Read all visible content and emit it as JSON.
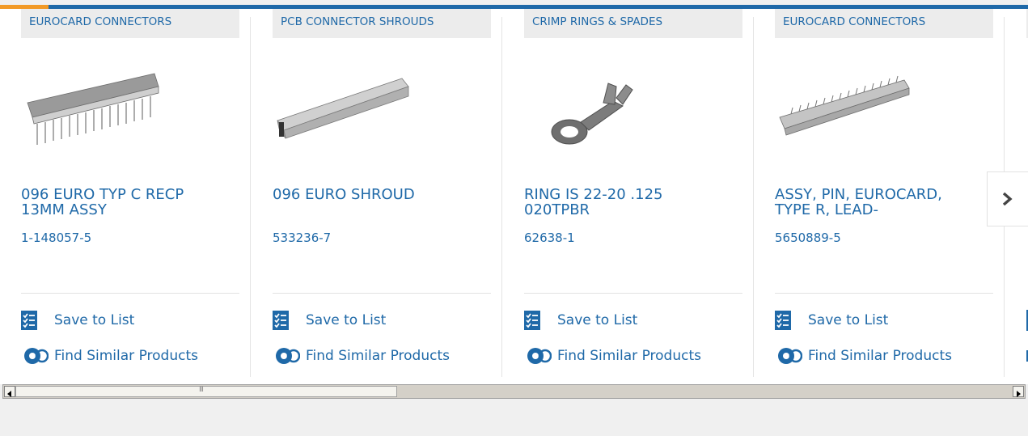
{
  "colors": {
    "link": "#1f69a8",
    "accent": "#f29a27",
    "category_bg": "#ececec"
  },
  "save_label": "Save to List",
  "find_label": "Find Similar Products",
  "cards": [
    {
      "category": "EUROCARD CONNECTORS",
      "title": "096 EURO TYP C RECP 13MM ASSY",
      "part_number": "1-148057-5",
      "image_icon": "eurocard-receptacle-image"
    },
    {
      "category": "PCB CONNECTOR SHROUDS",
      "title": "096 EURO SHROUD",
      "part_number": "533236-7",
      "image_icon": "connector-shroud-image"
    },
    {
      "category": "CRIMP RINGS & SPADES",
      "title": "RING IS 22-20 .125 020TPBR",
      "part_number": "62638-1",
      "image_icon": "ring-terminal-image"
    },
    {
      "category": "EUROCARD CONNECTORS",
      "title": "ASSY, PIN, EUROCARD, TYPE R, LEAD-",
      "part_number": "5650889-5",
      "image_icon": "eurocard-pin-assembly-image"
    }
  ],
  "next_icon": "chevron-right-icon",
  "scrollbar": {
    "left_arrow_icon": "scroll-left-arrow-icon",
    "right_arrow_icon": "scroll-right-arrow-icon",
    "thumb_grip": "III"
  }
}
